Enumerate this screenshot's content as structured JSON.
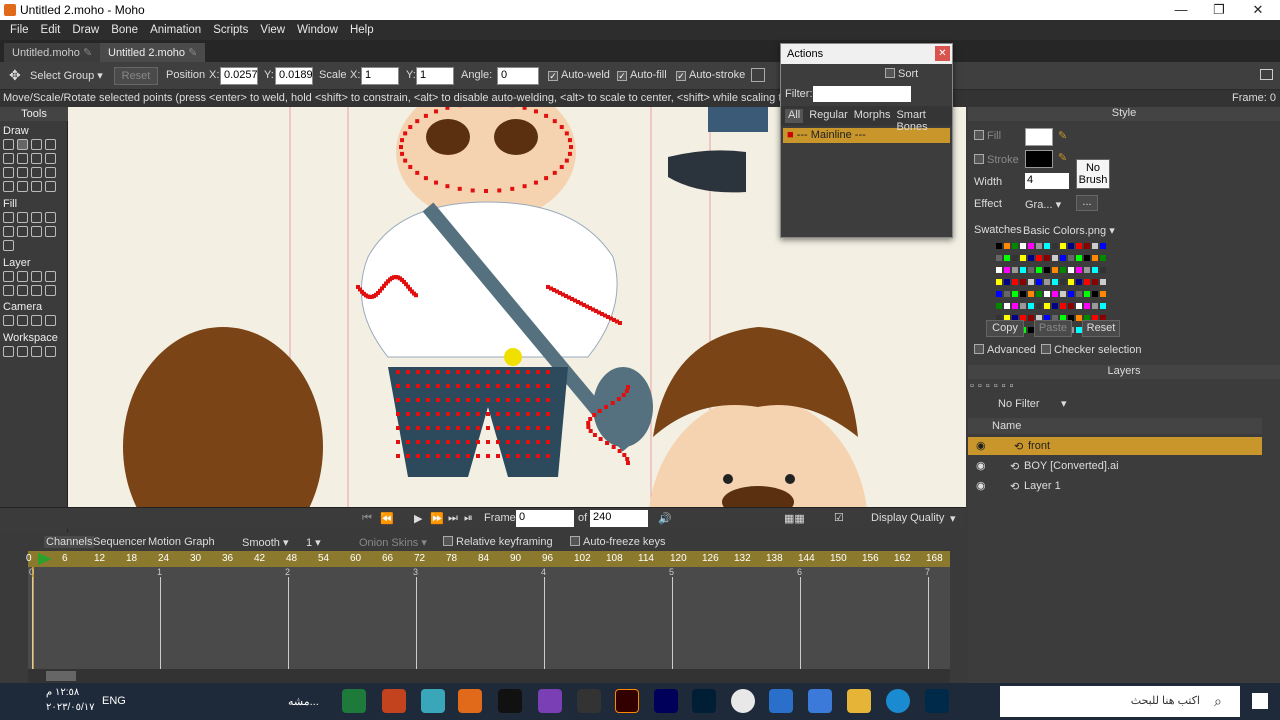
{
  "window": {
    "title": "Untitled 2.moho - Moho",
    "min": "—",
    "max": "❐",
    "close": "✕"
  },
  "menu": [
    "File",
    "Edit",
    "Draw",
    "Bone",
    "Animation",
    "Scripts",
    "View",
    "Window",
    "Help"
  ],
  "doc_tabs": [
    {
      "label": "Untitled.moho"
    },
    {
      "label": "Untitled 2.moho"
    }
  ],
  "toolbar": {
    "mode": "Select Group",
    "reset": "Reset",
    "position": "Position",
    "x_label": "X:",
    "x": "0.0257",
    "y_label": "Y:",
    "y": "0.0189",
    "scale": "Scale",
    "sx_label": "X:",
    "sx": "1",
    "sy_label": "Y:",
    "sy": "1",
    "angle": "Angle:",
    "angle_val": "0",
    "autoweld": "Auto-weld",
    "autofill": "Auto-fill",
    "autostroke": "Auto-stroke"
  },
  "status": {
    "text": "Move/Scale/Rotate selected points (press <enter> to weld, hold <shift> to constrain, <alt> to disable auto-welding, <alt> to scale to center, <shift> while scaling to squash, <ctrl> to ...",
    "frame": "Frame: 0"
  },
  "tools": {
    "title": "Tools",
    "draw": "Draw",
    "fill": "Fill",
    "layer": "Layer",
    "camera": "Camera",
    "workspace": "Workspace"
  },
  "actions": {
    "title": "Actions",
    "sort": "Sort",
    "filter": "Filter:",
    "tabs": [
      "All",
      "Regular",
      "Morphs",
      "Smart Bones"
    ],
    "item": "--- Mainline ---"
  },
  "playbar": {
    "frame_label": "Frame",
    "frame": "0",
    "of": "of",
    "total": "240",
    "quality": "Display Quality"
  },
  "timeline": {
    "tabs": [
      "Channels",
      "Sequencer",
      "Motion Graph"
    ],
    "interp": "Smooth",
    "interp_n": "1",
    "onion": "Onion Skins",
    "relative": "Relative keyframing",
    "autofreeze": "Auto-freeze keys",
    "ruler": [
      "0",
      "6",
      "12",
      "18",
      "24",
      "30",
      "36",
      "42",
      "48",
      "54",
      "60",
      "66",
      "72",
      "78",
      "84",
      "90",
      "96",
      "102",
      "108",
      "114",
      "120",
      "126",
      "132",
      "138",
      "144",
      "150",
      "156",
      "162",
      "168"
    ],
    "seconds": [
      "0",
      "1",
      "2",
      "3",
      "4",
      "5",
      "6",
      "7"
    ]
  },
  "style": {
    "title": "Style",
    "fill": "Fill",
    "stroke": "Stroke",
    "width": "Width",
    "width_val": "4",
    "no_brush": "No Brush",
    "effect": "Effect",
    "effect_val": "Gra...",
    "effect_more": "...",
    "swatches": "Swatches",
    "swatches_val": "Basic Colors.png",
    "copy": "Copy",
    "paste": "Paste",
    "reset": "Reset",
    "advanced": "Advanced",
    "checker": "Checker selection"
  },
  "layers": {
    "title": "Layers",
    "filter": "No Filter",
    "name_col": "Name",
    "items": [
      {
        "name": "front"
      },
      {
        "name": "BOY [Converted].ai"
      },
      {
        "name": "Layer 1"
      }
    ]
  },
  "taskbar": {
    "search": "اكتب هنا للبحث",
    "time": "١٢:٥٨ م",
    "date": "٢٠٢٣/٠٥/١٧",
    "lang": "ENG",
    "app_label": "مشه..."
  },
  "colors": {
    "accent": "#c8962a",
    "selected_layer": "#c8962a",
    "points": "#e01010"
  }
}
